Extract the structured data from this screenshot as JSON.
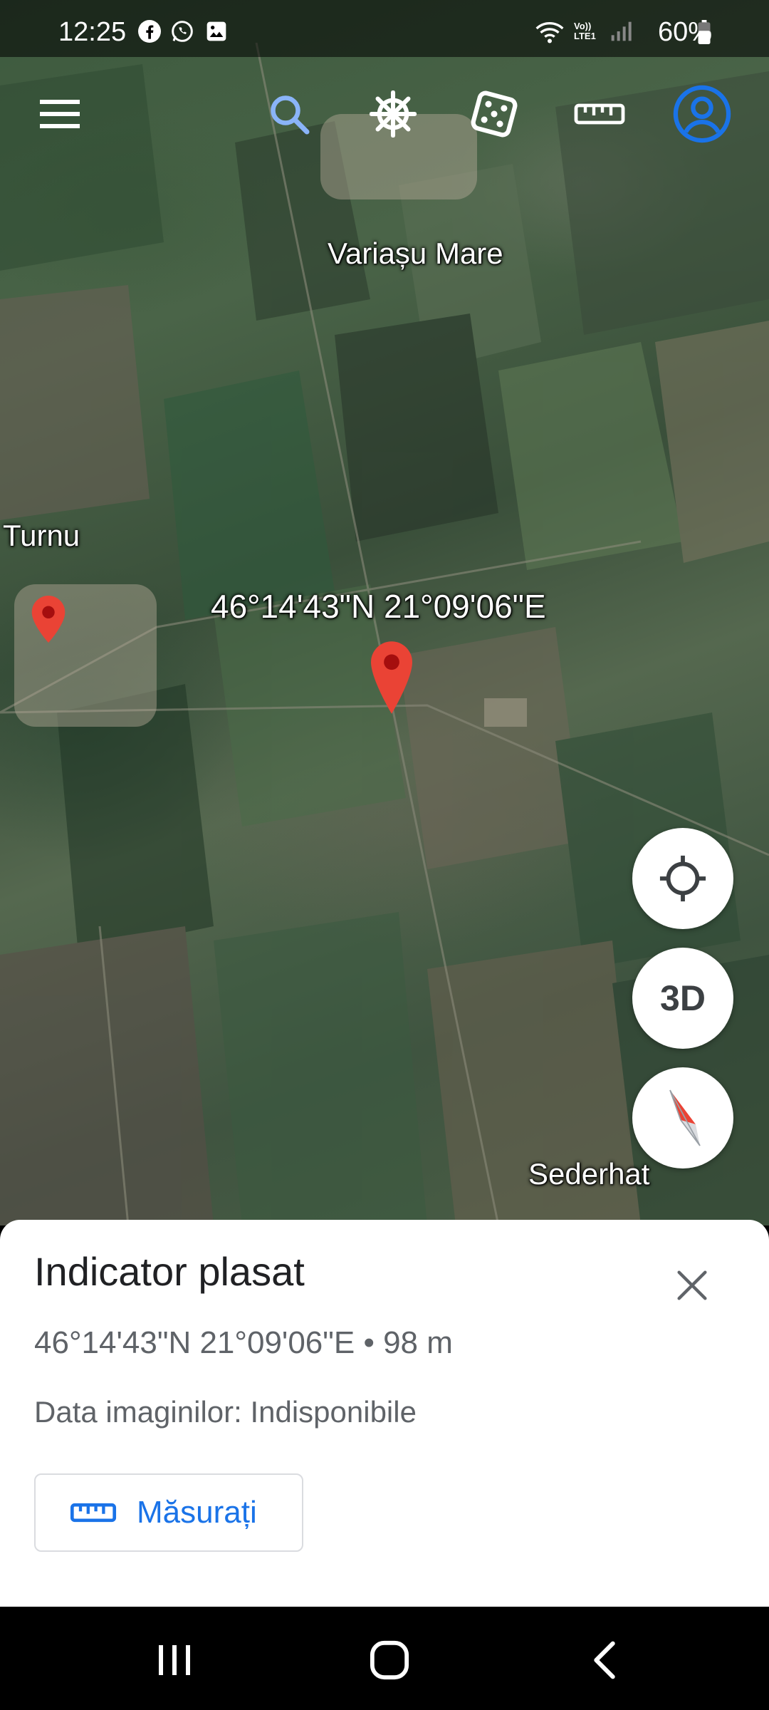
{
  "status_bar": {
    "time": "12:25",
    "battery": "60%",
    "icons": [
      "facebook-icon",
      "whatsapp-icon",
      "gallery-icon",
      "wifi-icon",
      "volte-icon",
      "signal-icon",
      "battery-icon"
    ],
    "volte_text": "Vo)) LTE1"
  },
  "toolbar": {
    "icons": [
      "menu-icon",
      "search-icon",
      "voyager-wheel-icon",
      "dice-icon",
      "ruler-icon",
      "account-icon"
    ],
    "accent_color": "#1a73e8"
  },
  "map": {
    "labels": {
      "village_north": "Variașu Mare",
      "village_west": "Turnu",
      "village_southeast": "Sederhat",
      "pin_coords": "46°14'43\"N 21°09'06\"E"
    },
    "pin_color": "#ea4335"
  },
  "side_buttons": {
    "location": "my-location-icon",
    "three_d": "3D",
    "compass": "compass-icon"
  },
  "sheet": {
    "title": "Indicator plasat",
    "coords": "46°14'43\"N 21°09'06\"E • 98 m",
    "imagery_date": "Data imaginilor: Indisponibile",
    "measure_button": "Măsurați"
  },
  "nav_bar": {
    "icons": [
      "recent-apps-icon",
      "home-icon",
      "back-icon"
    ]
  }
}
